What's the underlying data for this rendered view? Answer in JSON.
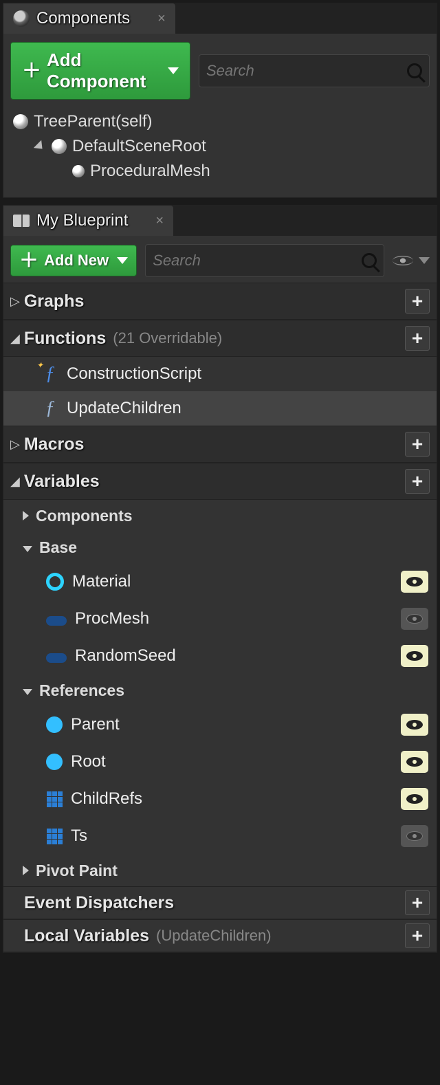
{
  "componentsPanel": {
    "tabTitle": "Components",
    "addButton": "Add Component",
    "searchPlaceholder": "Search",
    "tree": {
      "root": "TreeParent(self)",
      "sceneRoot": "DefaultSceneRoot",
      "child1": "ProceduralMesh"
    }
  },
  "blueprintPanel": {
    "tabTitle": "My Blueprint",
    "addButton": "Add New",
    "searchPlaceholder": "Search",
    "sections": {
      "graphs": {
        "title": "Graphs"
      },
      "functions": {
        "title": "Functions",
        "subtitle": "(21 Overridable)",
        "items": [
          {
            "name": "ConstructionScript"
          },
          {
            "name": "UpdateChildren"
          }
        ]
      },
      "macros": {
        "title": "Macros"
      },
      "variables": {
        "title": "Variables",
        "groups": {
          "components": "Components",
          "base": {
            "title": "Base",
            "items": [
              {
                "name": "Material",
                "icon": "ring",
                "visible": true
              },
              {
                "name": "ProcMesh",
                "icon": "pill",
                "visible": false
              },
              {
                "name": "RandomSeed",
                "icon": "pill",
                "visible": true
              }
            ]
          },
          "references": {
            "title": "References",
            "items": [
              {
                "name": "Parent",
                "icon": "ball",
                "visible": true
              },
              {
                "name": "Root",
                "icon": "ball",
                "visible": true
              },
              {
                "name": "ChildRefs",
                "icon": "grid",
                "visible": true
              },
              {
                "name": "Ts",
                "icon": "grid",
                "visible": false
              }
            ]
          },
          "pivotPaint": "Pivot Paint"
        }
      },
      "eventDispatchers": {
        "title": "Event Dispatchers"
      },
      "localVariables": {
        "title": "Local Variables",
        "subtitle": "(UpdateChildren)"
      }
    }
  }
}
